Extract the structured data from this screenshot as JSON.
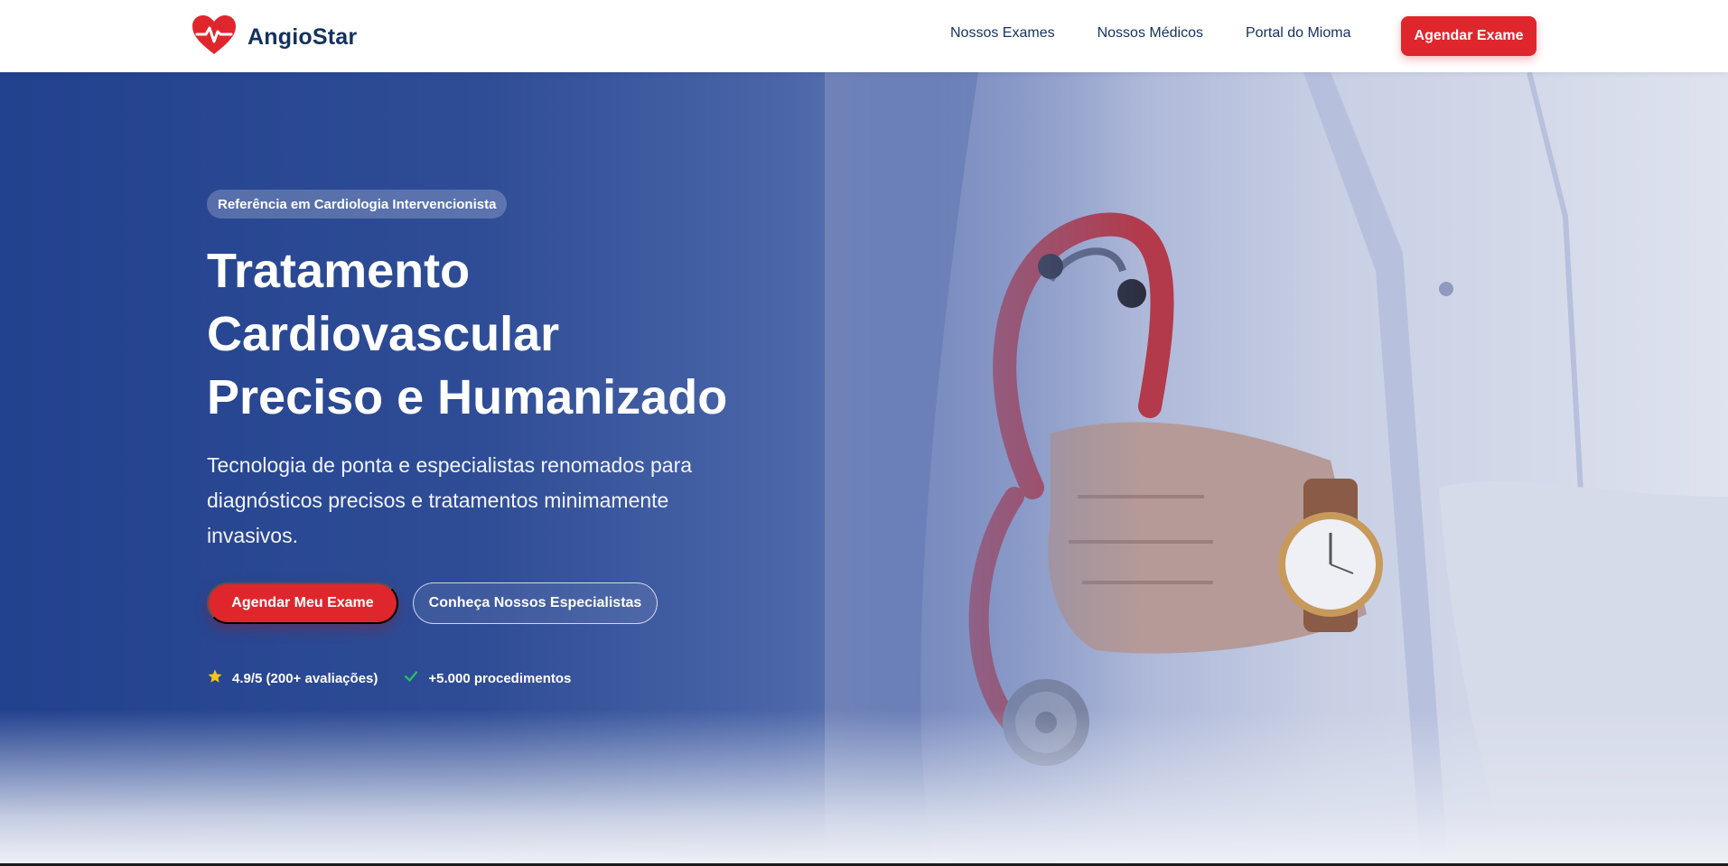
{
  "brand": {
    "name": "AngioStar",
    "logo_icon": "heart-pulse-icon",
    "logo_color": "#e0262d",
    "text_color": "#13325f"
  },
  "nav": {
    "items": [
      {
        "label": "Nossos Exames"
      },
      {
        "label": "Nossos Médicos"
      },
      {
        "label": "Portal do Mioma"
      }
    ],
    "cta_label": "Agendar Exame"
  },
  "hero": {
    "badge": "Referência em Cardiologia Intervencionista",
    "title_lines": [
      "Tratamento",
      "Cardiovascular",
      "Preciso e Humanizado"
    ],
    "subtitle": "Tecnologia de ponta e especialistas renomados para diagnósticos precisos e tratamentos minimamente invasivos.",
    "primary_button": "Agendar Meu Exame",
    "secondary_button": "Conheça Nossos Especialistas",
    "stats": [
      {
        "icon": "star-icon",
        "text": "4.9/5 (200+ avaliações)"
      },
      {
        "icon": "check-icon",
        "text": "+5.000 procedimentos"
      }
    ],
    "image": "doctor-with-stethoscope-photo"
  },
  "colors": {
    "accent": "#e0262d",
    "hero_blue": "#22418e",
    "star": "#f5c518",
    "check": "#22c55e"
  }
}
